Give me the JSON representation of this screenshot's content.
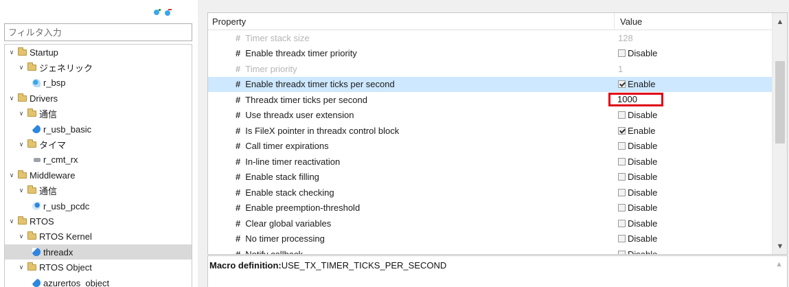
{
  "left_panel": {
    "filter_placeholder": "フィルタ入力",
    "tree": [
      {
        "label": "Startup",
        "level": 0,
        "kind": "folder",
        "expanded": true
      },
      {
        "label": "ジェネリック",
        "level": 1,
        "kind": "folder",
        "expanded": true
      },
      {
        "label": "r_bsp",
        "level": 2,
        "kind": "component",
        "icon": "bsp-component-icon"
      },
      {
        "label": "Drivers",
        "level": 0,
        "kind": "folder",
        "expanded": true
      },
      {
        "label": "通信",
        "level": 1,
        "kind": "folder",
        "expanded": true
      },
      {
        "label": "r_usb_basic",
        "level": 2,
        "kind": "component",
        "icon": "usb-component-icon"
      },
      {
        "label": "タイマ",
        "level": 1,
        "kind": "folder",
        "expanded": true
      },
      {
        "label": "r_cmt_rx",
        "level": 2,
        "kind": "component",
        "icon": "cmt-component-icon"
      },
      {
        "label": "Middleware",
        "level": 0,
        "kind": "folder",
        "expanded": true
      },
      {
        "label": "通信",
        "level": 1,
        "kind": "folder",
        "expanded": true
      },
      {
        "label": "r_usb_pcdc",
        "level": 2,
        "kind": "component",
        "icon": "pcdc-component-icon"
      },
      {
        "label": "RTOS",
        "level": 0,
        "kind": "folder",
        "expanded": true
      },
      {
        "label": "RTOS Kernel",
        "level": 1,
        "kind": "folder",
        "expanded": true
      },
      {
        "label": "threadx",
        "level": 2,
        "kind": "component",
        "icon": "threadx-component-icon",
        "selected": true
      },
      {
        "label": "RTOS Object",
        "level": 1,
        "kind": "folder",
        "expanded": true
      },
      {
        "label": "azurertos_object",
        "level": 2,
        "kind": "component",
        "icon": "threadx-component-icon"
      }
    ]
  },
  "property_table": {
    "header_property": "Property",
    "header_value": "Value",
    "rows": [
      {
        "name": "Timer stack size",
        "value": "128",
        "type": "text",
        "enabled": false
      },
      {
        "name": "Enable threadx timer priority",
        "value": "Disable",
        "type": "checkbox",
        "checked": false,
        "enabled": true
      },
      {
        "name": "Timer priority",
        "value": "1",
        "type": "text",
        "enabled": false
      },
      {
        "name": "Enable threadx timer ticks per second",
        "value": "Enable",
        "type": "checkbox",
        "checked": true,
        "enabled": true,
        "selected": true
      },
      {
        "name": "Threadx timer ticks per second",
        "value": "1000",
        "type": "edit",
        "enabled": true,
        "highlighted": true
      },
      {
        "name": "Use threadx user extension",
        "value": "Disable",
        "type": "checkbox",
        "checked": false,
        "enabled": true
      },
      {
        "name": "Is FileX pointer in threadx control block",
        "value": "Enable",
        "type": "checkbox",
        "checked": true,
        "enabled": true
      },
      {
        "name": "Call timer expirations",
        "value": "Disable",
        "type": "checkbox",
        "checked": false,
        "enabled": true
      },
      {
        "name": "In-line timer reactivation",
        "value": "Disable",
        "type": "checkbox",
        "checked": false,
        "enabled": true
      },
      {
        "name": "Enable stack filling",
        "value": "Disable",
        "type": "checkbox",
        "checked": false,
        "enabled": true
      },
      {
        "name": "Enable stack checking",
        "value": "Disable",
        "type": "checkbox",
        "checked": false,
        "enabled": true
      },
      {
        "name": "Enable preemption-threshold",
        "value": "Disable",
        "type": "checkbox",
        "checked": false,
        "enabled": true
      },
      {
        "name": "Clear global variables",
        "value": "Disable",
        "type": "checkbox",
        "checked": false,
        "enabled": true
      },
      {
        "name": "No timer processing",
        "value": "Disable",
        "type": "checkbox",
        "checked": false,
        "enabled": true
      },
      {
        "name": "Notify callback",
        "value": "Disable",
        "type": "checkbox",
        "checked": false,
        "enabled": true
      }
    ]
  },
  "macro_definition": {
    "label": "Macro definition:",
    "value": "USE_TX_TIMER_TICKS_PER_SECOND"
  },
  "colors": {
    "selected_row": "#cde8ff",
    "selected_tree": "#d9d9d9",
    "highlight_box": "#e00016",
    "disabled_text": "#b5b5b5"
  }
}
